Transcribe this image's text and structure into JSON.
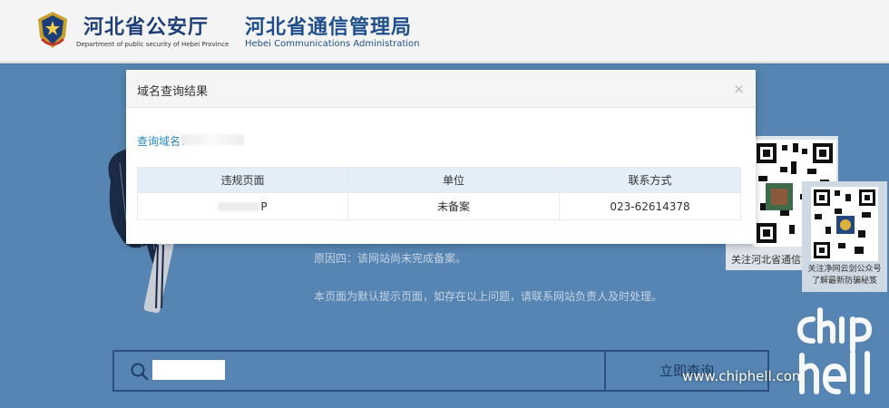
{
  "header": {
    "org1_title": "河北省公安厅",
    "org1_subtitle": "Department of public security of Hebei Province",
    "org2_title": "河北省通信管理局",
    "org2_subtitle": "Hebei Communications Administration"
  },
  "background": {
    "reason_text": "原因四：该网站尚未完成备案。",
    "notice_text": "本页面为默认提示页面，如存在以上问题，请联系网站负责人及时处理。",
    "search_button": "立即查询",
    "search_value": ""
  },
  "qr_cards": [
    {
      "label": "关注河北省通信管理局"
    },
    {
      "label_lines": [
        "关注净网云剑公众号",
        "了解最新防骗秘笈"
      ]
    }
  ],
  "modal": {
    "title": "域名查询结果",
    "close_icon": "×",
    "query_label": "查询域名：",
    "table": {
      "headers": [
        "违规页面",
        "单位",
        "联系方式"
      ],
      "rows": [
        {
          "page_suffix": "P",
          "unit": "未备案",
          "contact": "023-62614378"
        }
      ]
    }
  },
  "watermark": {
    "text": "www.chiphell.com",
    "logo": "chip hell"
  },
  "colors": {
    "header_bg": "#f4f4f4",
    "title_blue": "#1e3f78",
    "background_blue": "#4f80ad",
    "table_header_bg": "#e3eef9",
    "link_blue": "#2b88c8"
  }
}
